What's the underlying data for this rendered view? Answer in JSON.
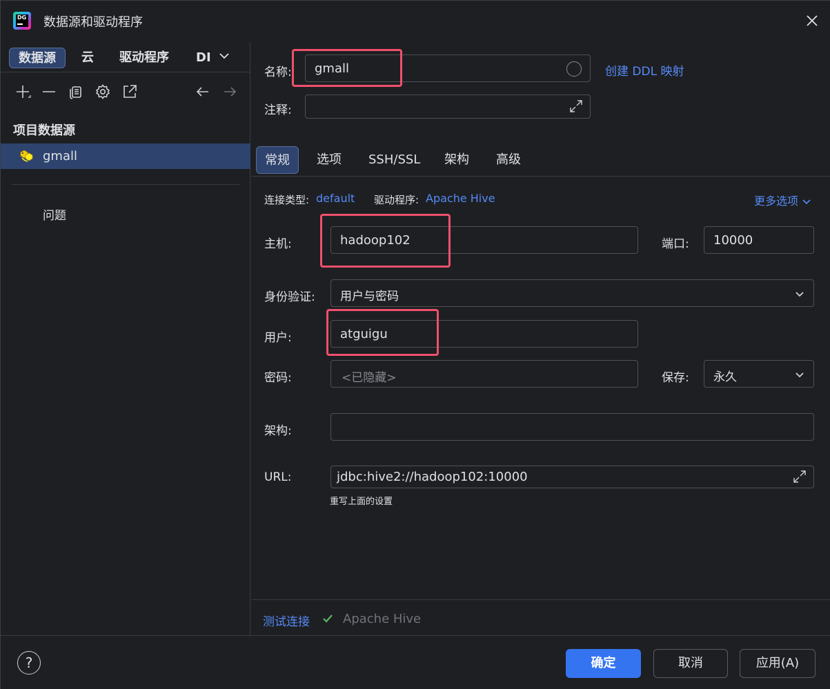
{
  "window": {
    "title": "数据源和驱动程序",
    "app_icon": "datagrip-logo",
    "logo_text": "DG"
  },
  "left": {
    "tabs": [
      "数据源",
      "云",
      "驱动程序",
      "DI"
    ],
    "toolbar_icons": [
      "add-icon",
      "remove-icon",
      "copy-icon",
      "gear-icon",
      "export-icon",
      "back-arrow-icon",
      "forward-arrow-icon"
    ],
    "section_title": "项目数据源",
    "datasource": "gmall",
    "problems": "问题"
  },
  "form": {
    "name_label": "名称:",
    "name_value": "gmall",
    "ddl_link": "创建 DDL 映射",
    "comment_label": "注释:",
    "tabs": [
      "常规",
      "选项",
      "SSH/SSL",
      "架构",
      "高级"
    ],
    "conn_type_label": "连接类型:",
    "conn_type_value": "default",
    "driver_label": "驱动程序:",
    "driver_value": "Apache Hive",
    "more_options": "更多选项",
    "host_label": "主机:",
    "host_value": "hadoop102",
    "port_label": "端口:",
    "port_value": "10000",
    "auth_label": "身份验证:",
    "auth_value": "用户与密码",
    "user_label": "用户:",
    "user_value": "atguigu",
    "password_label": "密码:",
    "password_placeholder": "<已隐藏>",
    "save_label": "保存:",
    "save_value": "永久",
    "schema_label": "架构:",
    "url_label": "URL:",
    "url_value": "jdbc:hive2://hadoop102:10000",
    "url_hint": "重写上面的设置"
  },
  "status": {
    "test_link": "测试连接",
    "result": "Apache Hive"
  },
  "footer": {
    "help": "?",
    "ok": "确定",
    "cancel": "取消",
    "apply": "应用(A)"
  },
  "colors": {
    "accent": "#3574f0",
    "link": "#548af7",
    "highlight_box": "#f0506e",
    "success": "#5fb865"
  }
}
